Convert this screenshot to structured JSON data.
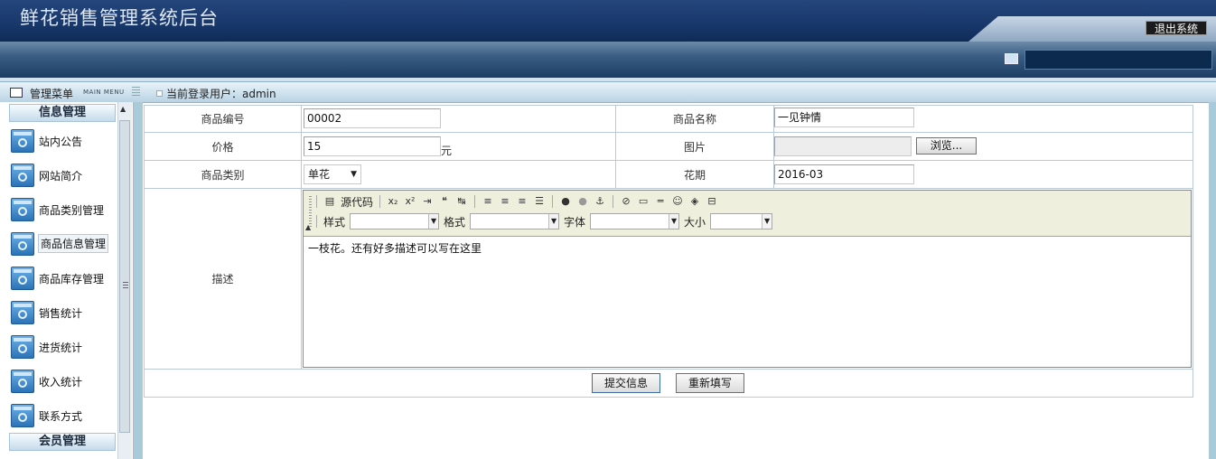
{
  "app": {
    "title": "鲜花销售管理系统后台",
    "logout_label": "退出系统"
  },
  "menubar": {
    "title": "管理菜单",
    "subtitle": "MAIN MENU",
    "current_user_label": "当前登录用户：admin"
  },
  "sidebar": {
    "sections": [
      {
        "title": "信息管理"
      },
      {
        "title": "会员管理"
      }
    ],
    "items": [
      {
        "label": "站内公告"
      },
      {
        "label": "网站简介"
      },
      {
        "label": "商品类别管理"
      },
      {
        "label": "商品信息管理"
      },
      {
        "label": "商品库存管理"
      },
      {
        "label": "销售统计"
      },
      {
        "label": "进货统计"
      },
      {
        "label": "收入统计"
      },
      {
        "label": "联系方式"
      }
    ]
  },
  "form": {
    "code_label": "商品编号",
    "code_value": "00002",
    "name_label": "商品名称",
    "name_value": "一见钟情",
    "price_label": "价格",
    "price_value": "15",
    "price_unit": "元",
    "image_label": "图片",
    "browse_label": "浏览...",
    "category_label": "商品类别",
    "category_value": "单花",
    "season_label": "花期",
    "season_value": "2016-03",
    "desc_label": "描述",
    "submit_label": "提交信息",
    "reset_label": "重新填写"
  },
  "editor": {
    "source_label": "源代码",
    "style_label": "样式",
    "format_label": "格式",
    "font_label": "字体",
    "size_label": "大小",
    "content": "一枝花。还有好多描述可以写在这里"
  }
}
